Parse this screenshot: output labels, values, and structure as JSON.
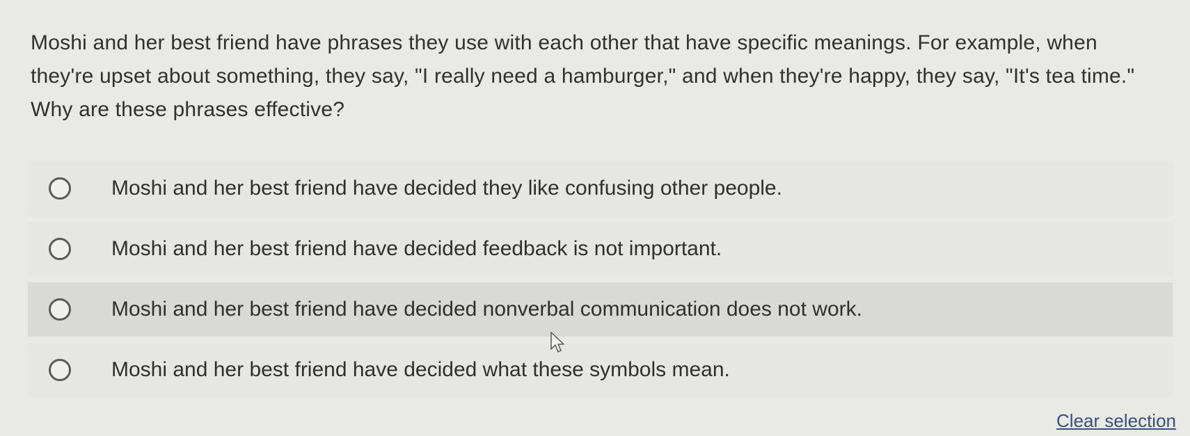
{
  "question": {
    "text": "Moshi and her best friend have phrases they use with each other that have specific meanings. For example, when they're upset about something, they say, \"I really need a hamburger,\" and when they're happy, they say, \"It's tea time.\" Why are these phrases effective?"
  },
  "options": [
    {
      "label": "Moshi and her best friend have decided they like confusing other people."
    },
    {
      "label": "Moshi and her best friend have decided feedback is not important."
    },
    {
      "label": "Moshi and her best friend have decided nonverbal communication does not work."
    },
    {
      "label": "Moshi and her best friend have decided what these symbols mean."
    }
  ],
  "clear_selection": "Clear selection",
  "icons": {
    "radio": "radio-unselected-icon",
    "cursor": "mouse-pointer-icon"
  },
  "colors": {
    "background": "#e9e9e6",
    "hover_row": "#d9d9d6",
    "link": "#3a4f7a"
  }
}
